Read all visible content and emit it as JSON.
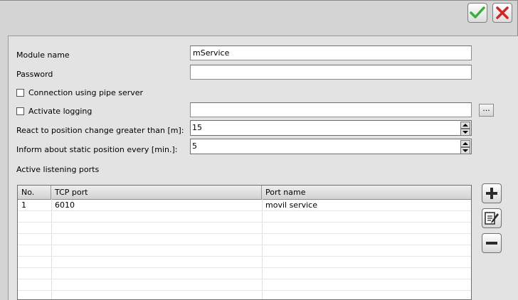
{
  "toolbar": {
    "ok_icon": "checkmark-icon",
    "close_icon": "close-icon"
  },
  "form": {
    "module_name_label": "Module name",
    "module_name_value": "mService",
    "password_label": "Password",
    "password_value": "",
    "pipe_server_label": "Connection using pipe server",
    "pipe_server_checked": false,
    "logging_label": "Activate logging",
    "logging_checked": false,
    "logging_path_value": "",
    "browse_label": "...",
    "react_label": "React to position change greater than [m]:",
    "react_value": "15",
    "inform_label": "Inform about static position every [min.]:",
    "inform_value": "5",
    "ports_label": "Active listening ports"
  },
  "ports_table": {
    "columns": [
      "No.",
      "TCP port",
      "Port name"
    ],
    "rows": [
      {
        "no": "1",
        "port": "6010",
        "name": "movil service"
      }
    ]
  },
  "side_buttons": {
    "add_icon": "plus-icon",
    "edit_icon": "edit-icon",
    "remove_icon": "minus-icon"
  },
  "colors": {
    "ok_green": "#3cae3c",
    "close_red": "#d0282a"
  }
}
